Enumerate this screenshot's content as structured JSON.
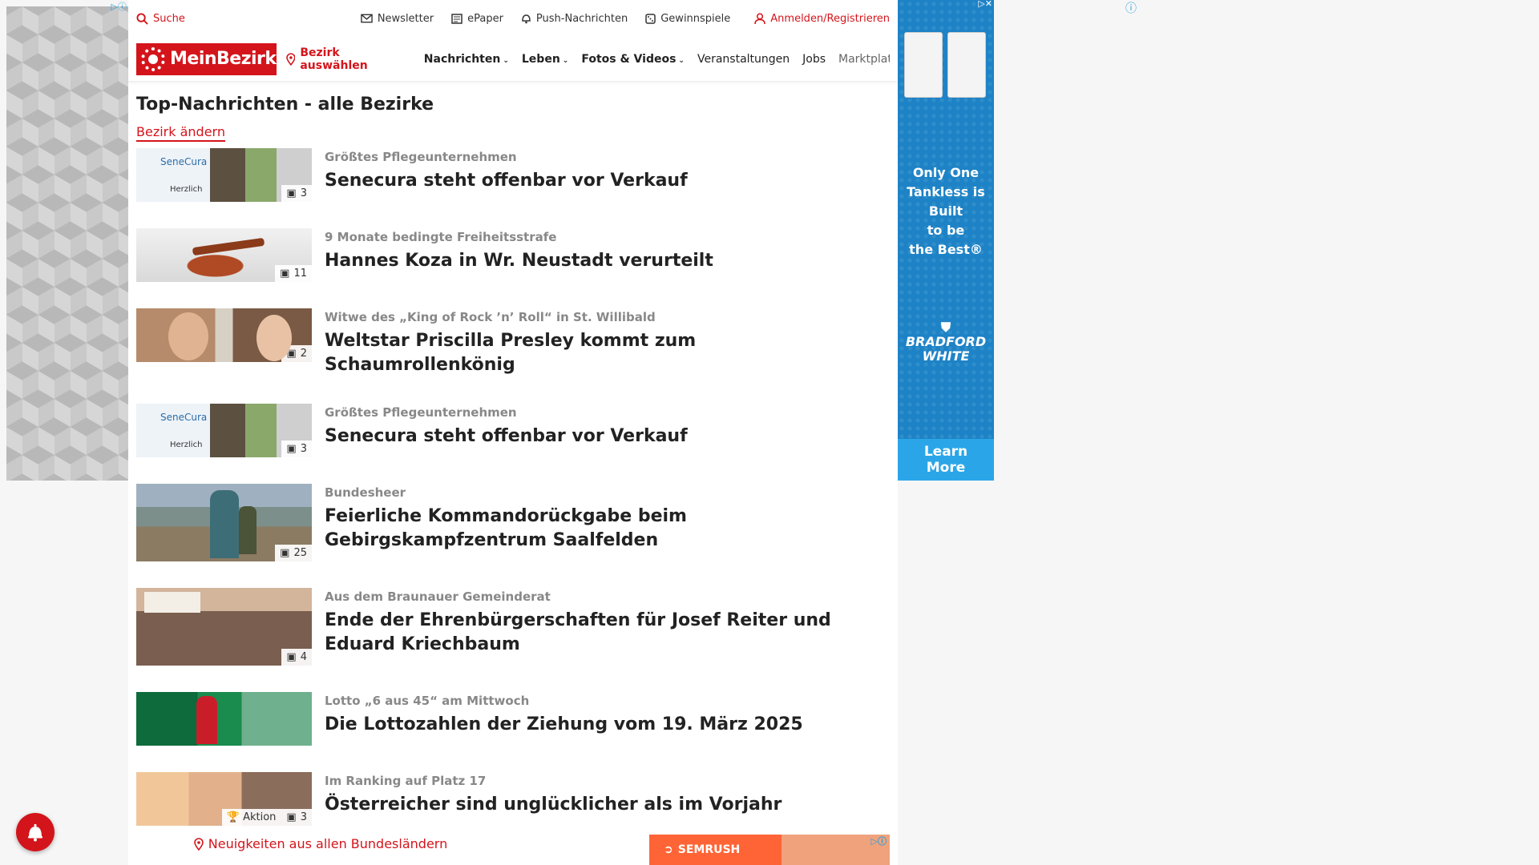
{
  "topbar": {
    "search": "Suche",
    "links": [
      "Newsletter",
      "ePaper",
      "Push-Nachrichten",
      "Gewinnspiele"
    ],
    "login": "Anmelden/Registrieren"
  },
  "nav": {
    "logo": "MeinBezirk",
    "district": "Bezirk auswählen",
    "items": [
      "Nachrichten",
      "Leben",
      "Fotos & Videos",
      "Veranstaltungen",
      "Jobs",
      "Marktplatz"
    ]
  },
  "page": {
    "title": "Top-Nachrichten - alle Bezirke",
    "change_district": "Bezirk ändern"
  },
  "articles": [
    {
      "kicker": "Größtes Pflegeunternehmen",
      "headline": "Senecura steht offenbar vor Verkauf",
      "images": "3"
    },
    {
      "kicker": "9 Monate bedingte Freiheitsstrafe",
      "headline": "Hannes Koza in Wr. Neustadt verurteilt",
      "images": "11"
    },
    {
      "kicker": "Witwe des „King of Rock ’n’ Roll“ in St. Willibald",
      "headline": "Weltstar Priscilla Presley kommt zum Schaumrollenkönig",
      "images": "2"
    },
    {
      "kicker": "Größtes Pflegeunternehmen",
      "headline": "Senecura steht offenbar vor Verkauf",
      "images": "3"
    },
    {
      "kicker": "Bundesheer",
      "headline": "Feierliche Kommandorückgabe beim Gebirgskampfzentrum Saalfelden",
      "images": "25"
    },
    {
      "kicker": "Aus dem Braunauer Gemeinderat",
      "headline": "Ende der Ehrenbürgerschaften für Josef Reiter und Eduard Kriechbaum",
      "images": "4"
    },
    {
      "kicker": "Lotto „6 aus 45“ am Mittwoch",
      "headline": "Die Lottozahlen der Ziehung vom 19. März 2025",
      "images": ""
    },
    {
      "kicker": "Im Ranking auf Platz 17",
      "headline": "Österreicher sind unglücklicher als im Vorjahr",
      "images": "3",
      "badge": "Aktion"
    }
  ],
  "footer": {
    "note": "Neuigkeiten aus allen Bundesländern"
  },
  "ads": {
    "right_text": [
      "Only One",
      "Tankless is",
      "Built",
      "to be",
      "the Best®"
    ],
    "right_brand": [
      "BRADFORD",
      "WHITE"
    ],
    "right_cta": [
      "Learn",
      "More"
    ],
    "bottom_brand": "SEMRUSH"
  },
  "colors": {
    "brand": "#d4141b",
    "ad_blue": "#1e82c6"
  }
}
